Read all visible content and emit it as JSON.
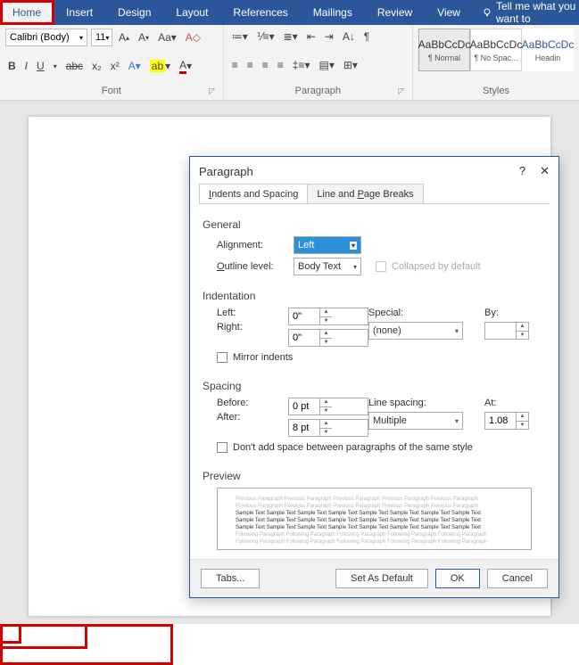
{
  "tabs": {
    "home": "Home",
    "insert": "Insert",
    "design": "Design",
    "layout": "Layout",
    "references": "References",
    "mailings": "Mailings",
    "review": "Review",
    "view": "View",
    "tellme": "Tell me what you want to"
  },
  "ribbon": {
    "font_name": "Calibri (Body)",
    "font_size": "11",
    "font_group": "Font",
    "para_group": "Paragraph",
    "styles_group": "Styles",
    "styles": [
      {
        "preview": "AaBbCcDc",
        "name": "¶ Normal"
      },
      {
        "preview": "AaBbCcDc",
        "name": "¶ No Spac..."
      },
      {
        "preview": "AaBbCcDc",
        "name": "Headin"
      }
    ],
    "bold": "B",
    "italic": "I",
    "underline": "U",
    "strike": "abc",
    "sub": "x₂",
    "sup": "x²"
  },
  "dialog": {
    "title": "Paragraph",
    "tab1": "Indents and Spacing",
    "tab2": "Line and Page Breaks",
    "general": "General",
    "alignment_lbl": "Alignment:",
    "alignment_val": "Left",
    "outline_lbl": "Outline level:",
    "outline_val": "Body Text",
    "collapsed": "Collapsed by default",
    "indentation": "Indentation",
    "left_lbl": "Left:",
    "left_val": "0\"",
    "right_lbl": "Right:",
    "right_val": "0\"",
    "special_lbl": "Special:",
    "special_val": "(none)",
    "by_lbl": "By:",
    "by_val": "",
    "mirror": "Mirror indents",
    "spacing": "Spacing",
    "before_lbl": "Before:",
    "before_val": "0 pt",
    "after_lbl": "After:",
    "after_val": "8 pt",
    "linesp_lbl": "Line spacing:",
    "linesp_val": "Multiple",
    "at_lbl": "At:",
    "at_val": "1.08",
    "dontadd": "Don't add space between paragraphs of the same style",
    "preview": "Preview",
    "preview_grey": "Previous Paragraph Previous Paragraph Previous Paragraph Previous Paragraph Previous Paragraph",
    "preview_dark": "Sample Text Sample Text Sample Text Sample Text Sample Text Sample Text Sample Text Sample Text",
    "preview_grey2": "Following Paragraph Following Paragraph Following Paragraph Following Paragraph Following Paragraph",
    "tabs_btn": "Tabs...",
    "default_btn": "Set As Default",
    "ok_btn": "OK",
    "cancel_btn": "Cancel"
  }
}
